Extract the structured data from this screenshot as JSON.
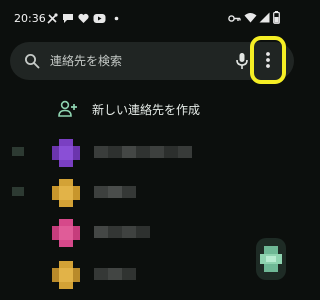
{
  "status_bar": {
    "time": "20:36",
    "icons": [
      "tools-icon",
      "chat-bubble-icon",
      "heart-icon",
      "youtube-icon",
      "notification-dot-icon",
      "key-icon",
      "wifi-icon",
      "signal-icon",
      "battery-icon"
    ]
  },
  "search": {
    "placeholder": "連絡先を検索",
    "icon": "search-icon",
    "mic_icon": "mic-icon",
    "menu_icon": "more-vert-icon",
    "highlight_color": "#f5ee24"
  },
  "create_contact": {
    "label": "新しい連絡先を作成",
    "icon": "person-add-icon",
    "icon_color": "#8fd3b0"
  },
  "contacts": [
    {
      "avatar_color": "#7a3fc2",
      "section_marker": true
    },
    {
      "avatar_color": "#d3a236",
      "section_marker": true
    },
    {
      "avatar_color": "#d6498a",
      "section_marker": false
    },
    {
      "avatar_color": "#d3a236",
      "section_marker": false
    }
  ],
  "fab": {
    "icon": "contacts-icon",
    "color": "#8fd3b0"
  }
}
